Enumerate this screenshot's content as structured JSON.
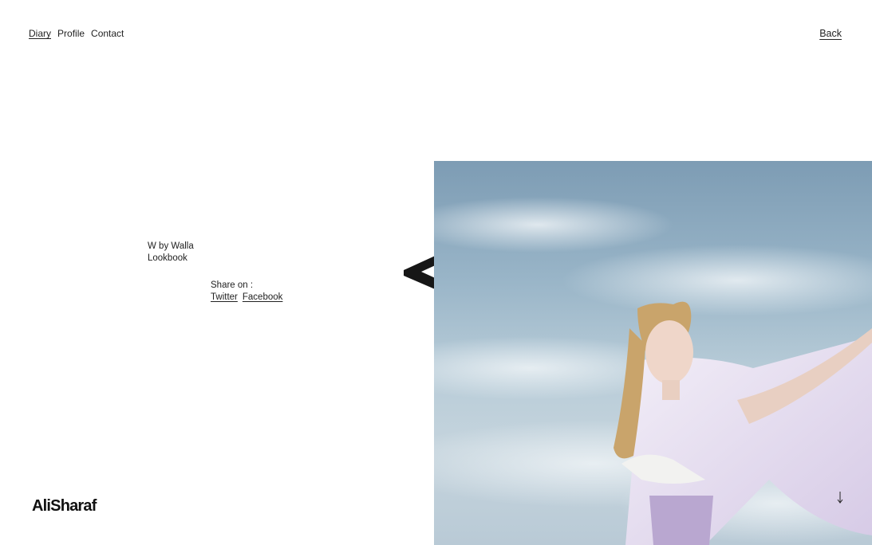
{
  "nav": {
    "items": [
      {
        "label": "Diary",
        "active": true
      },
      {
        "label": "Profile",
        "active": false
      },
      {
        "label": "Contact",
        "active": false
      }
    ]
  },
  "back_label": "Back",
  "project": {
    "title_line1": "W by Walla",
    "title_line2": "Lookbook"
  },
  "share": {
    "label": "Share on :",
    "twitter": "Twitter",
    "facebook": "Facebook"
  },
  "brand": "AliSharaf",
  "icons": {
    "logo_mark": "rotated-a-icon",
    "scroll": "arrow-down-icon"
  },
  "colors": {
    "text": "#222222",
    "sky": "#98b4c7",
    "dress": "#e4dcef"
  }
}
